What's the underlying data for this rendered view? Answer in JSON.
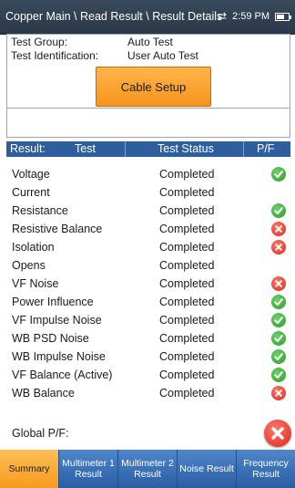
{
  "header": {
    "breadcrumb": "Copper Main \\ Read Result \\ Result Details",
    "time": "2:59 PM"
  },
  "info": {
    "test_group_label": "Test Group:",
    "test_group_value": "Auto Test",
    "test_id_label": "Test Identification:",
    "test_id_value": "User Auto Test",
    "cable_setup_label": "Cable Setup"
  },
  "table": {
    "col_result": "Result:",
    "col_test": "Test",
    "col_status": "Test Status",
    "col_pf": "P/F",
    "rows": [
      {
        "name": "Voltage",
        "status": "Completed",
        "pf": "pass"
      },
      {
        "name": "Current",
        "status": "Completed",
        "pf": ""
      },
      {
        "name": "Resistance",
        "status": "Completed",
        "pf": "pass"
      },
      {
        "name": "Resistive Balance",
        "status": "Completed",
        "pf": "fail"
      },
      {
        "name": "Isolation",
        "status": "Completed",
        "pf": "fail"
      },
      {
        "name": "Opens",
        "status": "Completed",
        "pf": ""
      },
      {
        "name": "VF Noise",
        "status": "Completed",
        "pf": "fail"
      },
      {
        "name": "Power Influence",
        "status": "Completed",
        "pf": "pass"
      },
      {
        "name": "VF Impulse Noise",
        "status": "Completed",
        "pf": "pass"
      },
      {
        "name": "WB PSD Noise",
        "status": "Completed",
        "pf": "pass"
      },
      {
        "name": "WB Impulse Noise",
        "status": "Completed",
        "pf": "pass"
      },
      {
        "name": "VF Balance (Active)",
        "status": "Completed",
        "pf": "pass"
      },
      {
        "name": "WB Balance",
        "status": "Completed",
        "pf": "fail"
      }
    ]
  },
  "global": {
    "label": "Global P/F:",
    "result": "fail"
  },
  "tabs": [
    {
      "label": "Summary",
      "active": true
    },
    {
      "label": "Multimeter 1 Result",
      "active": false
    },
    {
      "label": "Multimeter 2 Result",
      "active": false
    },
    {
      "label": "Noise Result",
      "active": false
    },
    {
      "label": "Frequency Result",
      "active": false
    }
  ],
  "colors": {
    "pass": "#2e9a2a",
    "fail": "#d9281a",
    "accent": "#f7941d",
    "header_blue": "#2f5e9e"
  }
}
